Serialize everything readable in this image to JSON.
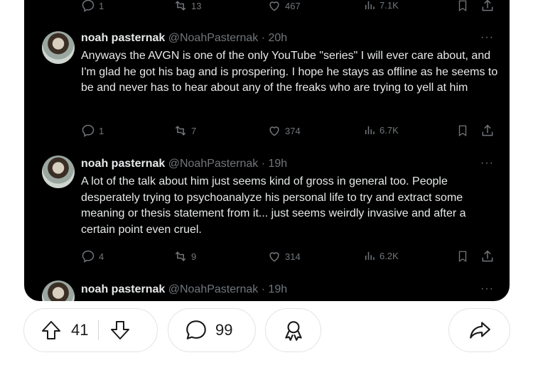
{
  "top_actions": {
    "replies": "1",
    "reposts": "13",
    "likes": "467",
    "views": "7.1K"
  },
  "tweets": [
    {
      "name": "noah pasternak",
      "handle": "@NoahPasternak",
      "time": "20h",
      "text": "Anyways the AVGN is one of the only YouTube \"series\" I will ever care about, and I'm glad he got his bag and is prospering. I hope he stays as offline as he seems to be and never has to hear about any of the freaks who are trying to yell at him",
      "replies": "1",
      "reposts": "7",
      "likes": "374",
      "views": "6.7K"
    },
    {
      "name": "noah pasternak",
      "handle": "@NoahPasternak",
      "time": "19h",
      "text": "A lot of the talk about him just seems kind of gross in general too. People desperately trying to psychoanalyze his personal life to try and extract some meaning or thesis statement from it... just seems weirdly invasive and after a certain point even cruel.",
      "replies": "4",
      "reposts": "9",
      "likes": "314",
      "views": "6.2K"
    },
    {
      "name": "noah pasternak",
      "handle": "@NoahPasternak",
      "time": "19h"
    }
  ],
  "bottom_bar": {
    "vote_count": "41",
    "comment_count": "99"
  },
  "icons": [
    "reply-icon",
    "repost-icon",
    "like-icon",
    "views-icon",
    "bookmark-icon",
    "share-icon",
    "upvote-icon",
    "downvote-icon",
    "comment-icon",
    "award-icon",
    "share-arrow-icon"
  ],
  "colors": {
    "card_bg": "#000000",
    "text": "#e7e9ea",
    "muted": "#71767b"
  }
}
